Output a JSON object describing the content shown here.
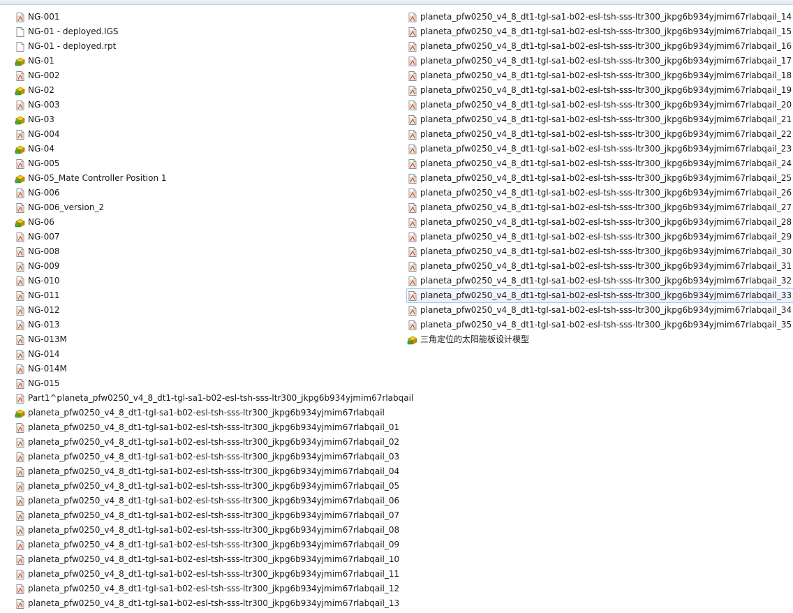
{
  "columns": [
    {
      "items": [
        {
          "label": "NG-001",
          "icon": "drawing-file-icon"
        },
        {
          "label": "NG-01 - deployed.IGS",
          "icon": "blank-file-icon"
        },
        {
          "label": "NG-01 - deployed.rpt",
          "icon": "blank-file-icon"
        },
        {
          "label": "NG-01",
          "icon": "assembly-file-icon"
        },
        {
          "label": "NG-002",
          "icon": "drawing-file-icon"
        },
        {
          "label": "NG-02",
          "icon": "assembly-file-icon"
        },
        {
          "label": "NG-003",
          "icon": "drawing-file-icon"
        },
        {
          "label": "NG-03",
          "icon": "assembly-file-icon"
        },
        {
          "label": "NG-004",
          "icon": "drawing-file-icon"
        },
        {
          "label": "NG-04",
          "icon": "assembly-file-icon"
        },
        {
          "label": "NG-005",
          "icon": "drawing-file-icon"
        },
        {
          "label": "NG-05_Mate Controller Position 1",
          "icon": "assembly-file-icon"
        },
        {
          "label": "NG-006",
          "icon": "drawing-file-icon"
        },
        {
          "label": "NG-006_version_2",
          "icon": "drawing-file-icon"
        },
        {
          "label": "NG-06",
          "icon": "assembly-file-icon"
        },
        {
          "label": "NG-007",
          "icon": "drawing-file-icon"
        },
        {
          "label": "NG-008",
          "icon": "drawing-file-icon"
        },
        {
          "label": "NG-009",
          "icon": "drawing-file-icon"
        },
        {
          "label": "NG-010",
          "icon": "drawing-file-icon"
        },
        {
          "label": "NG-011",
          "icon": "drawing-file-icon"
        },
        {
          "label": "NG-012",
          "icon": "drawing-file-icon"
        },
        {
          "label": "NG-013",
          "icon": "drawing-file-icon"
        },
        {
          "label": "NG-013M",
          "icon": "drawing-file-icon"
        },
        {
          "label": "NG-014",
          "icon": "drawing-file-icon"
        },
        {
          "label": "NG-014M",
          "icon": "drawing-file-icon"
        },
        {
          "label": "NG-015",
          "icon": "drawing-file-icon"
        },
        {
          "label": "Part1^planeta_pfw0250_v4_8_dt1-tgl-sa1-b02-esl-tsh-sss-ltr300_jkpg6b934yjmim67rlabqail",
          "icon": "drawing-file-icon"
        },
        {
          "label": "planeta_pfw0250_v4_8_dt1-tgl-sa1-b02-esl-tsh-sss-ltr300_jkpg6b934yjmim67rlabqail",
          "icon": "assembly-file-icon"
        },
        {
          "label": "planeta_pfw0250_v4_8_dt1-tgl-sa1-b02-esl-tsh-sss-ltr300_jkpg6b934yjmim67rlabqail_01",
          "icon": "drawing-file-icon"
        },
        {
          "label": "planeta_pfw0250_v4_8_dt1-tgl-sa1-b02-esl-tsh-sss-ltr300_jkpg6b934yjmim67rlabqail_02",
          "icon": "drawing-file-icon"
        },
        {
          "label": "planeta_pfw0250_v4_8_dt1-tgl-sa1-b02-esl-tsh-sss-ltr300_jkpg6b934yjmim67rlabqail_03",
          "icon": "drawing-file-icon"
        },
        {
          "label": "planeta_pfw0250_v4_8_dt1-tgl-sa1-b02-esl-tsh-sss-ltr300_jkpg6b934yjmim67rlabqail_04",
          "icon": "drawing-file-icon"
        },
        {
          "label": "planeta_pfw0250_v4_8_dt1-tgl-sa1-b02-esl-tsh-sss-ltr300_jkpg6b934yjmim67rlabqail_05",
          "icon": "drawing-file-icon"
        },
        {
          "label": "planeta_pfw0250_v4_8_dt1-tgl-sa1-b02-esl-tsh-sss-ltr300_jkpg6b934yjmim67rlabqail_06",
          "icon": "drawing-file-icon"
        },
        {
          "label": "planeta_pfw0250_v4_8_dt1-tgl-sa1-b02-esl-tsh-sss-ltr300_jkpg6b934yjmim67rlabqail_07",
          "icon": "drawing-file-icon"
        },
        {
          "label": "planeta_pfw0250_v4_8_dt1-tgl-sa1-b02-esl-tsh-sss-ltr300_jkpg6b934yjmim67rlabqail_08",
          "icon": "drawing-file-icon"
        },
        {
          "label": "planeta_pfw0250_v4_8_dt1-tgl-sa1-b02-esl-tsh-sss-ltr300_jkpg6b934yjmim67rlabqail_09",
          "icon": "drawing-file-icon"
        },
        {
          "label": "planeta_pfw0250_v4_8_dt1-tgl-sa1-b02-esl-tsh-sss-ltr300_jkpg6b934yjmim67rlabqail_10",
          "icon": "drawing-file-icon"
        },
        {
          "label": "planeta_pfw0250_v4_8_dt1-tgl-sa1-b02-esl-tsh-sss-ltr300_jkpg6b934yjmim67rlabqail_11",
          "icon": "drawing-file-icon"
        },
        {
          "label": "planeta_pfw0250_v4_8_dt1-tgl-sa1-b02-esl-tsh-sss-ltr300_jkpg6b934yjmim67rlabqail_12",
          "icon": "drawing-file-icon"
        },
        {
          "label": "planeta_pfw0250_v4_8_dt1-tgl-sa1-b02-esl-tsh-sss-ltr300_jkpg6b934yjmim67rlabqail_13",
          "icon": "drawing-file-icon"
        }
      ]
    },
    {
      "items": [
        {
          "label": "planeta_pfw0250_v4_8_dt1-tgl-sa1-b02-esl-tsh-sss-ltr300_jkpg6b934yjmim67rlabqail_14",
          "icon": "drawing-file-icon"
        },
        {
          "label": "planeta_pfw0250_v4_8_dt1-tgl-sa1-b02-esl-tsh-sss-ltr300_jkpg6b934yjmim67rlabqail_15",
          "icon": "drawing-file-icon"
        },
        {
          "label": "planeta_pfw0250_v4_8_dt1-tgl-sa1-b02-esl-tsh-sss-ltr300_jkpg6b934yjmim67rlabqail_16",
          "icon": "drawing-file-icon"
        },
        {
          "label": "planeta_pfw0250_v4_8_dt1-tgl-sa1-b02-esl-tsh-sss-ltr300_jkpg6b934yjmim67rlabqail_17",
          "icon": "drawing-file-icon"
        },
        {
          "label": "planeta_pfw0250_v4_8_dt1-tgl-sa1-b02-esl-tsh-sss-ltr300_jkpg6b934yjmim67rlabqail_18",
          "icon": "drawing-file-icon"
        },
        {
          "label": "planeta_pfw0250_v4_8_dt1-tgl-sa1-b02-esl-tsh-sss-ltr300_jkpg6b934yjmim67rlabqail_19",
          "icon": "drawing-file-icon"
        },
        {
          "label": "planeta_pfw0250_v4_8_dt1-tgl-sa1-b02-esl-tsh-sss-ltr300_jkpg6b934yjmim67rlabqail_20",
          "icon": "drawing-file-icon"
        },
        {
          "label": "planeta_pfw0250_v4_8_dt1-tgl-sa1-b02-esl-tsh-sss-ltr300_jkpg6b934yjmim67rlabqail_21",
          "icon": "drawing-file-icon"
        },
        {
          "label": "planeta_pfw0250_v4_8_dt1-tgl-sa1-b02-esl-tsh-sss-ltr300_jkpg6b934yjmim67rlabqail_22",
          "icon": "drawing-file-icon"
        },
        {
          "label": "planeta_pfw0250_v4_8_dt1-tgl-sa1-b02-esl-tsh-sss-ltr300_jkpg6b934yjmim67rlabqail_23",
          "icon": "drawing-file-icon"
        },
        {
          "label": "planeta_pfw0250_v4_8_dt1-tgl-sa1-b02-esl-tsh-sss-ltr300_jkpg6b934yjmim67rlabqail_24",
          "icon": "drawing-file-icon"
        },
        {
          "label": "planeta_pfw0250_v4_8_dt1-tgl-sa1-b02-esl-tsh-sss-ltr300_jkpg6b934yjmim67rlabqail_25",
          "icon": "drawing-file-icon"
        },
        {
          "label": "planeta_pfw0250_v4_8_dt1-tgl-sa1-b02-esl-tsh-sss-ltr300_jkpg6b934yjmim67rlabqail_26",
          "icon": "drawing-file-icon"
        },
        {
          "label": "planeta_pfw0250_v4_8_dt1-tgl-sa1-b02-esl-tsh-sss-ltr300_jkpg6b934yjmim67rlabqail_27",
          "icon": "drawing-file-icon"
        },
        {
          "label": "planeta_pfw0250_v4_8_dt1-tgl-sa1-b02-esl-tsh-sss-ltr300_jkpg6b934yjmim67rlabqail_28",
          "icon": "drawing-file-icon"
        },
        {
          "label": "planeta_pfw0250_v4_8_dt1-tgl-sa1-b02-esl-tsh-sss-ltr300_jkpg6b934yjmim67rlabqail_29",
          "icon": "drawing-file-icon"
        },
        {
          "label": "planeta_pfw0250_v4_8_dt1-tgl-sa1-b02-esl-tsh-sss-ltr300_jkpg6b934yjmim67rlabqail_30",
          "icon": "drawing-file-icon"
        },
        {
          "label": "planeta_pfw0250_v4_8_dt1-tgl-sa1-b02-esl-tsh-sss-ltr300_jkpg6b934yjmim67rlabqail_31",
          "icon": "drawing-file-icon"
        },
        {
          "label": "planeta_pfw0250_v4_8_dt1-tgl-sa1-b02-esl-tsh-sss-ltr300_jkpg6b934yjmim67rlabqail_32",
          "icon": "drawing-file-icon"
        },
        {
          "label": "planeta_pfw0250_v4_8_dt1-tgl-sa1-b02-esl-tsh-sss-ltr300_jkpg6b934yjmim67rlabqail_33",
          "icon": "drawing-file-icon",
          "selected": true
        },
        {
          "label": "planeta_pfw0250_v4_8_dt1-tgl-sa1-b02-esl-tsh-sss-ltr300_jkpg6b934yjmim67rlabqail_34",
          "icon": "drawing-file-icon"
        },
        {
          "label": "planeta_pfw0250_v4_8_dt1-tgl-sa1-b02-esl-tsh-sss-ltr300_jkpg6b934yjmim67rlabqail_35",
          "icon": "drawing-file-icon"
        },
        {
          "label": "三角定位的太阳能板设计模型",
          "icon": "assembly-file-icon"
        }
      ]
    }
  ],
  "colors": {
    "selection_border": "#a9c6e9",
    "selection_fill": "#e9f1fb",
    "assembly_yellow": "#f2cf1a",
    "assembly_green": "#3cae3a",
    "drawing_red": "#c8323a"
  }
}
